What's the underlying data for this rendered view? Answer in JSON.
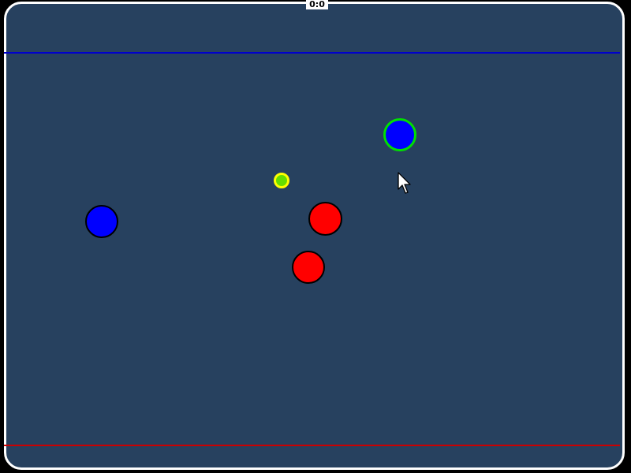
{
  "score": {
    "text": "0:0"
  },
  "colors": {
    "field": "#27415f",
    "boundary": "#ffffff",
    "blue_goal_line": "#0000cc",
    "red_goal_line": "#cc0000",
    "blue_team": "#0000ff",
    "red_team": "#ff0000",
    "player_outline": "#000000",
    "controlled_player_outline": "#00e000",
    "ball_fill": "#66dd00",
    "ball_outline": "#ffff00"
  },
  "icons": {
    "cursor": "mouse-pointer-icon"
  }
}
